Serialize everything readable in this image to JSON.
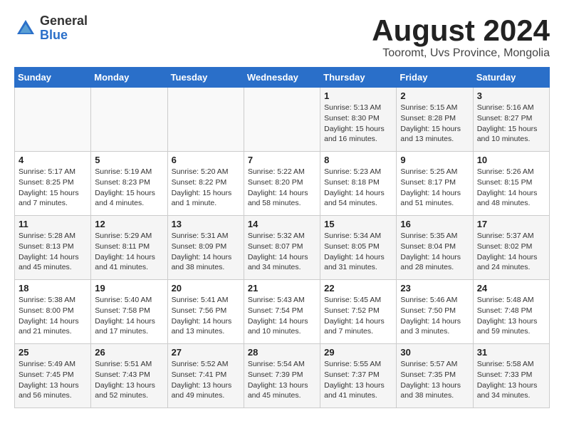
{
  "logo": {
    "general": "General",
    "blue": "Blue"
  },
  "title": "August 2024",
  "subtitle": "Tooromt, Uvs Province, Mongolia",
  "days_of_week": [
    "Sunday",
    "Monday",
    "Tuesday",
    "Wednesday",
    "Thursday",
    "Friday",
    "Saturday"
  ],
  "weeks": [
    [
      {
        "day": "",
        "info": ""
      },
      {
        "day": "",
        "info": ""
      },
      {
        "day": "",
        "info": ""
      },
      {
        "day": "",
        "info": ""
      },
      {
        "day": "1",
        "info": "Sunrise: 5:13 AM\nSunset: 8:30 PM\nDaylight: 15 hours and 16 minutes."
      },
      {
        "day": "2",
        "info": "Sunrise: 5:15 AM\nSunset: 8:28 PM\nDaylight: 15 hours and 13 minutes."
      },
      {
        "day": "3",
        "info": "Sunrise: 5:16 AM\nSunset: 8:27 PM\nDaylight: 15 hours and 10 minutes."
      }
    ],
    [
      {
        "day": "4",
        "info": "Sunrise: 5:17 AM\nSunset: 8:25 PM\nDaylight: 15 hours and 7 minutes."
      },
      {
        "day": "5",
        "info": "Sunrise: 5:19 AM\nSunset: 8:23 PM\nDaylight: 15 hours and 4 minutes."
      },
      {
        "day": "6",
        "info": "Sunrise: 5:20 AM\nSunset: 8:22 PM\nDaylight: 15 hours and 1 minute."
      },
      {
        "day": "7",
        "info": "Sunrise: 5:22 AM\nSunset: 8:20 PM\nDaylight: 14 hours and 58 minutes."
      },
      {
        "day": "8",
        "info": "Sunrise: 5:23 AM\nSunset: 8:18 PM\nDaylight: 14 hours and 54 minutes."
      },
      {
        "day": "9",
        "info": "Sunrise: 5:25 AM\nSunset: 8:17 PM\nDaylight: 14 hours and 51 minutes."
      },
      {
        "day": "10",
        "info": "Sunrise: 5:26 AM\nSunset: 8:15 PM\nDaylight: 14 hours and 48 minutes."
      }
    ],
    [
      {
        "day": "11",
        "info": "Sunrise: 5:28 AM\nSunset: 8:13 PM\nDaylight: 14 hours and 45 minutes."
      },
      {
        "day": "12",
        "info": "Sunrise: 5:29 AM\nSunset: 8:11 PM\nDaylight: 14 hours and 41 minutes."
      },
      {
        "day": "13",
        "info": "Sunrise: 5:31 AM\nSunset: 8:09 PM\nDaylight: 14 hours and 38 minutes."
      },
      {
        "day": "14",
        "info": "Sunrise: 5:32 AM\nSunset: 8:07 PM\nDaylight: 14 hours and 34 minutes."
      },
      {
        "day": "15",
        "info": "Sunrise: 5:34 AM\nSunset: 8:05 PM\nDaylight: 14 hours and 31 minutes."
      },
      {
        "day": "16",
        "info": "Sunrise: 5:35 AM\nSunset: 8:04 PM\nDaylight: 14 hours and 28 minutes."
      },
      {
        "day": "17",
        "info": "Sunrise: 5:37 AM\nSunset: 8:02 PM\nDaylight: 14 hours and 24 minutes."
      }
    ],
    [
      {
        "day": "18",
        "info": "Sunrise: 5:38 AM\nSunset: 8:00 PM\nDaylight: 14 hours and 21 minutes."
      },
      {
        "day": "19",
        "info": "Sunrise: 5:40 AM\nSunset: 7:58 PM\nDaylight: 14 hours and 17 minutes."
      },
      {
        "day": "20",
        "info": "Sunrise: 5:41 AM\nSunset: 7:56 PM\nDaylight: 14 hours and 13 minutes."
      },
      {
        "day": "21",
        "info": "Sunrise: 5:43 AM\nSunset: 7:54 PM\nDaylight: 14 hours and 10 minutes."
      },
      {
        "day": "22",
        "info": "Sunrise: 5:45 AM\nSunset: 7:52 PM\nDaylight: 14 hours and 7 minutes."
      },
      {
        "day": "23",
        "info": "Sunrise: 5:46 AM\nSunset: 7:50 PM\nDaylight: 14 hours and 3 minutes."
      },
      {
        "day": "24",
        "info": "Sunrise: 5:48 AM\nSunset: 7:48 PM\nDaylight: 13 hours and 59 minutes."
      }
    ],
    [
      {
        "day": "25",
        "info": "Sunrise: 5:49 AM\nSunset: 7:45 PM\nDaylight: 13 hours and 56 minutes."
      },
      {
        "day": "26",
        "info": "Sunrise: 5:51 AM\nSunset: 7:43 PM\nDaylight: 13 hours and 52 minutes."
      },
      {
        "day": "27",
        "info": "Sunrise: 5:52 AM\nSunset: 7:41 PM\nDaylight: 13 hours and 49 minutes."
      },
      {
        "day": "28",
        "info": "Sunrise: 5:54 AM\nSunset: 7:39 PM\nDaylight: 13 hours and 45 minutes."
      },
      {
        "day": "29",
        "info": "Sunrise: 5:55 AM\nSunset: 7:37 PM\nDaylight: 13 hours and 41 minutes."
      },
      {
        "day": "30",
        "info": "Sunrise: 5:57 AM\nSunset: 7:35 PM\nDaylight: 13 hours and 38 minutes."
      },
      {
        "day": "31",
        "info": "Sunrise: 5:58 AM\nSunset: 7:33 PM\nDaylight: 13 hours and 34 minutes."
      }
    ]
  ]
}
